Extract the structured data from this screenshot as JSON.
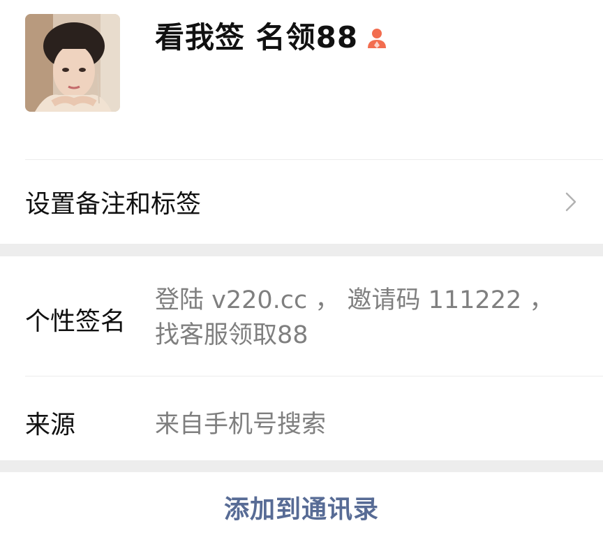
{
  "profile": {
    "display_name": "看我签 名领88",
    "gender_icon": "female-user-icon",
    "avatar_icon": "profile-photo"
  },
  "remark_row": {
    "label": "设置备注和标签",
    "chevron_icon": "chevron-right-icon"
  },
  "details": {
    "signature": {
      "key": "个性签名",
      "value": "登陆 v220.cc ， 邀请码 111222 ， 找客服领取88"
    },
    "source": {
      "key": "来源",
      "value": "来自手机号搜索"
    }
  },
  "actions": {
    "add_contact_label": "添加到通讯录"
  },
  "colors": {
    "link_blue": "#576b95",
    "gender_female": "#f26d4f",
    "separator_gray": "#ededed",
    "secondary_text": "#7f7f7f"
  }
}
